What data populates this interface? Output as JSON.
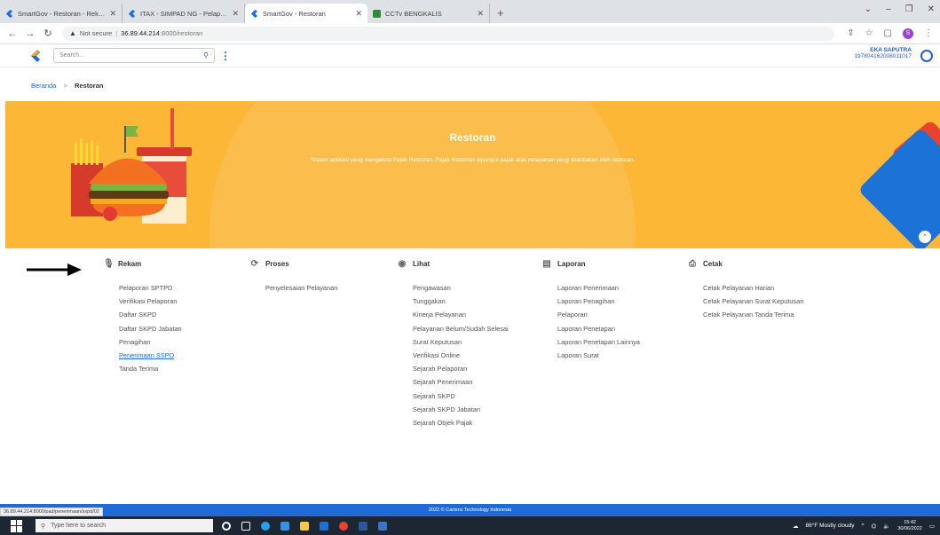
{
  "browser": {
    "tabs": [
      {
        "title": "SmartGov - Restoran - Rekam - P",
        "active": false
      },
      {
        "title": "ITAX - SIMPAD NG - Pelaporan -",
        "active": false
      },
      {
        "title": "SmartGov - Restoran",
        "active": true
      },
      {
        "title": "CCTv BENGKALIS",
        "active": false
      }
    ],
    "new_tab": "+",
    "not_secure": "Not secure",
    "url_host": "36.89.44.214",
    "url_path": ":8000/restoran"
  },
  "header": {
    "search_placeholder": "Search...",
    "user_name": "EKA SAPUTRA",
    "user_id": "197804162008011017"
  },
  "breadcrumb": {
    "home": "Beranda",
    "separator": ">",
    "current": "Restoran"
  },
  "banner": {
    "title": "Restoran",
    "subtitle": "Sistem aplikasi yang mengelola Pajak Restoran. Pajak Restoran dipungut pajak atas pelayanan yang disediakan oleh restoran."
  },
  "menus": [
    {
      "title": "Rekam",
      "icon": "mic-icon",
      "items": [
        "Pelaporan SPTPD",
        "Verifikasi Pelaporan",
        "Daftar SKPD",
        "Daftar SKPD Jabatan",
        "Penagihan",
        "Penerimaan SSPD",
        "Tanda Terima"
      ],
      "active_index": 5
    },
    {
      "title": "Proses",
      "icon": "refresh-icon",
      "items": [
        "Penyelesaian Pelayanan"
      ],
      "active_index": -1
    },
    {
      "title": "Lihat",
      "icon": "eye-icon",
      "items": [
        "Pengawasan",
        "Tunggakan",
        "Kinerja Pelayanan",
        "Pelayanan Belum/Sudah Selesai",
        "Surat Keputusan",
        "Verifikasi Online",
        "Sejarah Pelaporan",
        "Sejarah Penerimaan",
        "Sejarah SKPD",
        "Sejarah SKPD Jabatan",
        "Sejarah Objek Pajak"
      ],
      "active_index": -1
    },
    {
      "title": "Laporan",
      "icon": "document-icon",
      "items": [
        "Laporan Penerimaan",
        "Laporan Penagihan",
        "Pelaporan",
        "Laporan Penetapan",
        "Laporan Penetapan Lainnya",
        "Laporan Surat"
      ],
      "active_index": -1
    },
    {
      "title": "Cetak",
      "icon": "printer-icon",
      "items": [
        "Cetak Pelayanan Harian",
        "Cetak Pelayanan Surat Keputusan",
        "Cetak Pelayanan Tanda Terima"
      ],
      "active_index": -1
    }
  ],
  "status_url": "36.89.44.214:8000/pad/penerimaan/sspd/02",
  "footer": "2022 © Cartenz Technology Indonesia",
  "taskbar": {
    "search_placeholder": "Type here to search",
    "weather": "86°F  Mostly cloudy",
    "time": "15:42",
    "date": "30/06/2022"
  },
  "colors": {
    "accent": "#1e6bd6",
    "banner": "#fdb737"
  }
}
